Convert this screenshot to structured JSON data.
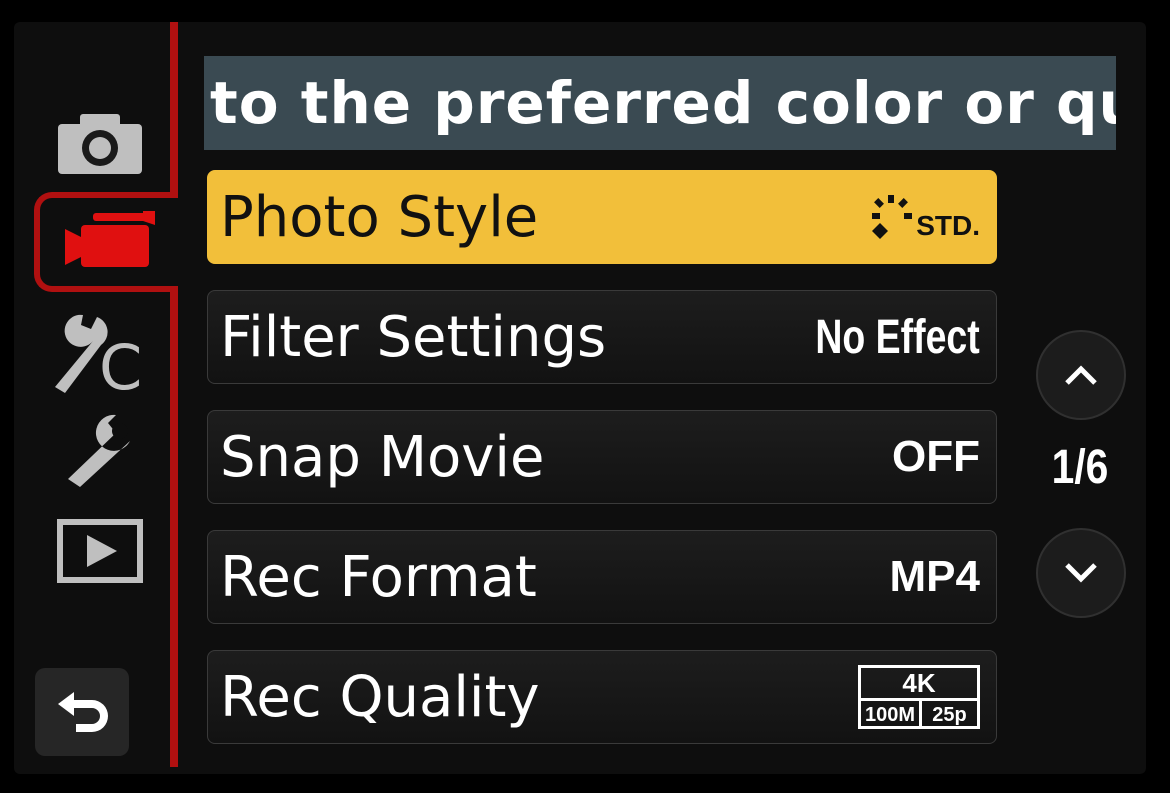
{
  "description": "to the preferred color or quality c",
  "tabs": [
    {
      "icon": "camera-icon"
    },
    {
      "icon": "movie-camera-icon",
      "active": true
    },
    {
      "icon": "custom-wrench-icon"
    },
    {
      "icon": "setup-wrench-icon"
    },
    {
      "icon": "playback-icon"
    }
  ],
  "menu": {
    "items": [
      {
        "label": "Photo Style",
        "value": "STD.",
        "icon": "photo-style-standard-icon",
        "selected": true
      },
      {
        "label": "Filter Settings",
        "value": "No Effect"
      },
      {
        "label": "Snap Movie",
        "value": "OFF"
      },
      {
        "label": "Rec Format",
        "value": "MP4"
      },
      {
        "label": "Rec Quality",
        "value_top": "4K",
        "value_bottom_left": "100M",
        "value_bottom_right": "25p"
      }
    ]
  },
  "page": "1/6",
  "back_icon": "back-arrow-icon",
  "colors": {
    "accent": "#b01010",
    "highlight": "#f2bf3a",
    "description_bg": "#3a4a52"
  }
}
